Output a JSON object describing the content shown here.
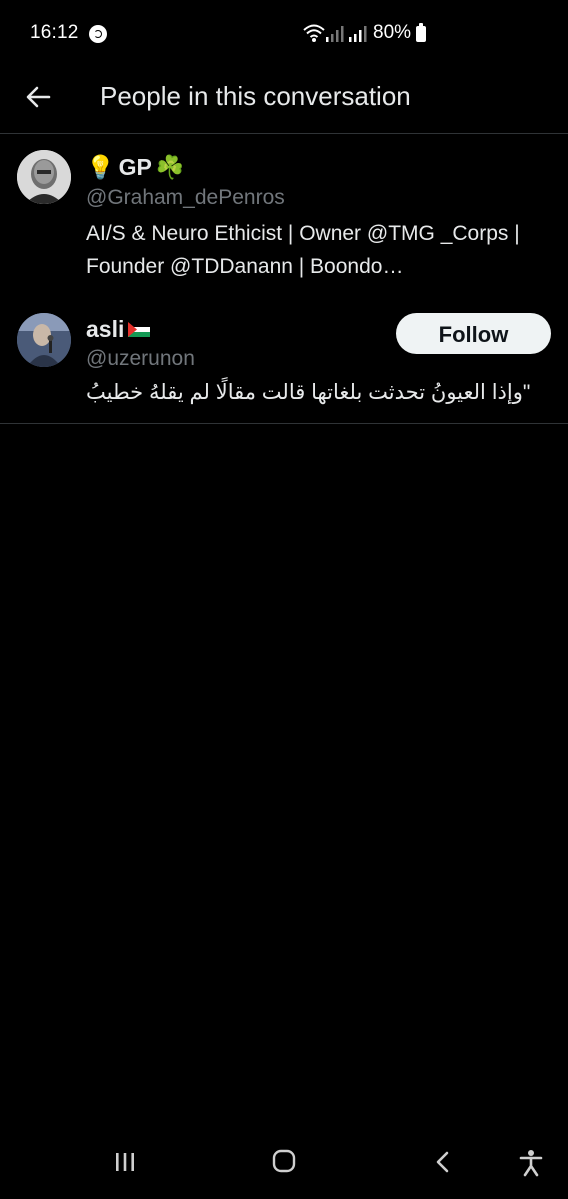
{
  "status_bar": {
    "time": "16:12",
    "battery": "80%",
    "icons": [
      "shazam-icon",
      "wifi-icon",
      "signal-icon",
      "signal-icon",
      "battery-icon"
    ]
  },
  "header": {
    "title": "People in this conversation",
    "back_icon": "back-arrow-icon"
  },
  "people": [
    {
      "name": "GP",
      "name_prefix_emoji": "💡",
      "name_suffix_emoji": "☘️",
      "handle": "@Graham_dePenros",
      "bio": "AI/S & Neuro Ethicist | Owner @TMG _Corps | Founder @TDDanann | Boondo…",
      "following": true
    },
    {
      "name": "asli",
      "name_suffix_emoji": "🇵🇸",
      "handle": "@uzerunon",
      "bio": "\"وإذا العيونُ تحدثت بلغاتها قالت مقالًا لم يقلهُ خطيبُ",
      "follow_label": "Follow",
      "following": false
    }
  ],
  "nav_bar": {
    "icons": [
      "recents-icon",
      "home-icon",
      "back-icon",
      "accessibility-icon"
    ]
  },
  "colors": {
    "background": "#000000",
    "text_primary": "#e7e9ea",
    "text_secondary": "#71767b",
    "divider": "#2f3336",
    "follow_button_bg": "#eff3f4",
    "follow_button_text": "#0f1419"
  }
}
